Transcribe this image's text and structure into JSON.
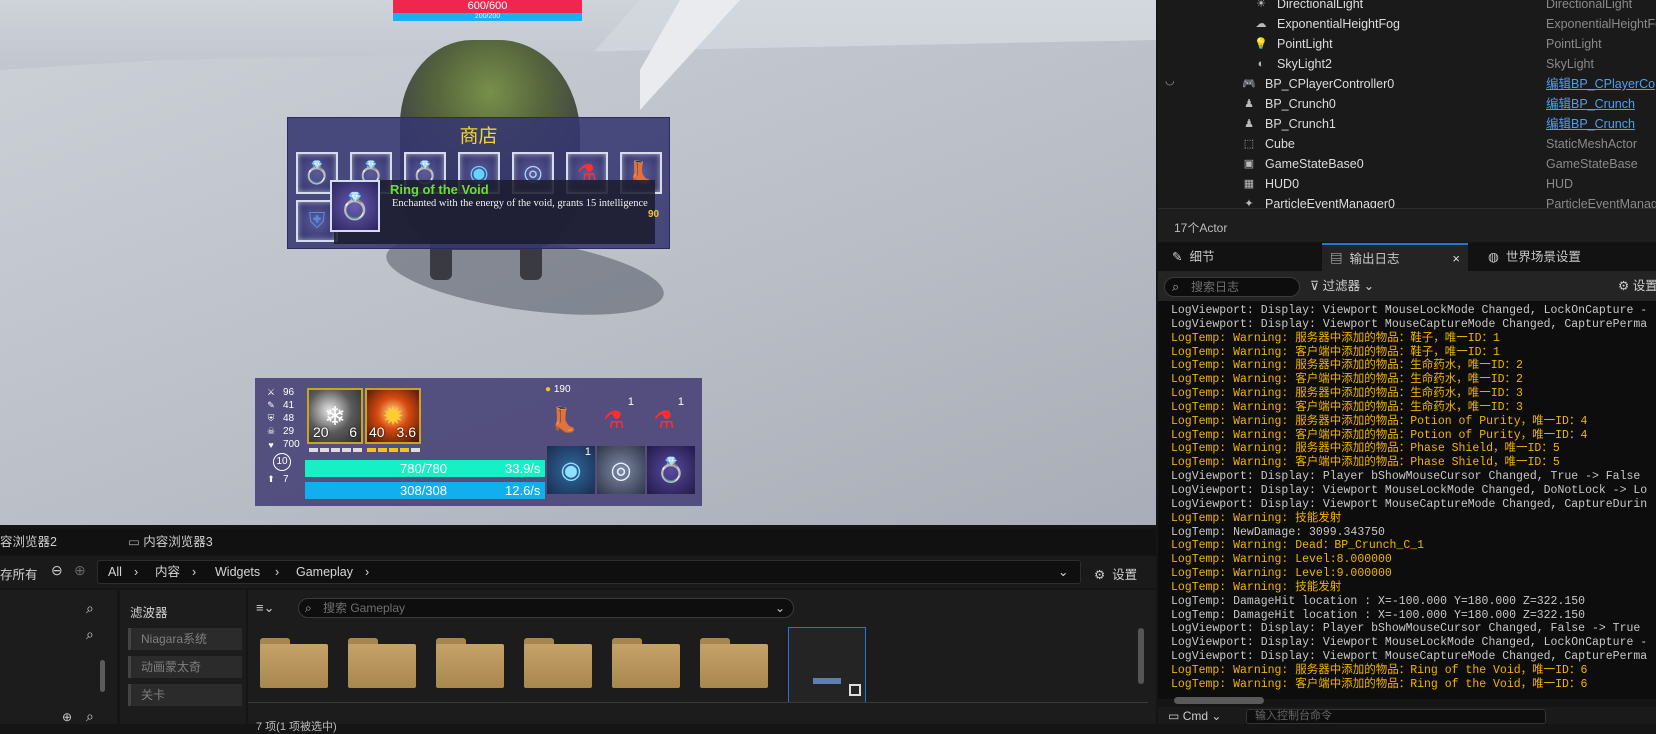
{
  "game": {
    "enemy_hp": "600/600",
    "enemy_mp": "200/200",
    "shop": {
      "title": "商店",
      "slots": [
        "ring-purple",
        "ring-gold",
        "ring-blue",
        "orb-cyan",
        "orb-shield",
        "potion-red",
        "boots-black",
        "armor-blue"
      ],
      "tooltip": {
        "name": "Ring of the Void",
        "description": "Enchanted with the energy of the void, grants 15 intelligence",
        "price": "90"
      }
    },
    "hud": {
      "stats": [
        {
          "icon": "sword-icon",
          "glyph": "⚔",
          "value": "96"
        },
        {
          "icon": "wand-icon",
          "glyph": "✎",
          "value": "41"
        },
        {
          "icon": "shield-icon",
          "glyph": "⛨",
          "value": "48"
        },
        {
          "icon": "mask-icon",
          "glyph": "☠",
          "value": "29"
        },
        {
          "icon": "heart-icon",
          "glyph": "♥",
          "value": "700"
        }
      ],
      "level": "10",
      "points": "7",
      "skills": [
        {
          "icon": "frost-skill-icon",
          "left_value": "20",
          "right_value": "6"
        },
        {
          "icon": "fire-skill-icon",
          "left_value": "40",
          "right_value": "3.6"
        }
      ],
      "hp": {
        "text": "780/780",
        "rate": "33.9/s",
        "fill": 1.0,
        "color": "#17f0c4"
      },
      "mp": {
        "text": "308/308",
        "rate": "12.6/s",
        "fill": 1.0,
        "color": "#11aef0"
      },
      "gold": "190",
      "inventory": [
        {
          "icon": "boots-icon",
          "count": ""
        },
        {
          "icon": "red-potion-icon",
          "count": "1"
        },
        {
          "icon": "red-potion-icon",
          "count": "1"
        },
        {
          "icon": "blue-orb-icon",
          "count": "1"
        },
        {
          "icon": "shield-orb-icon",
          "count": ""
        },
        {
          "icon": "void-ring-icon",
          "count": ""
        }
      ]
    }
  },
  "outliner": {
    "rows": [
      {
        "icon": "light-icon",
        "name": "DirectionalLight",
        "type": "DirectionalLight",
        "link": false,
        "indent": 2
      },
      {
        "icon": "fog-icon",
        "name": "ExponentialHeightFog",
        "type": "ExponentialHeightFog",
        "link": false,
        "indent": 2
      },
      {
        "icon": "bulb-icon",
        "name": "PointLight",
        "type": "PointLight",
        "link": false,
        "indent": 2
      },
      {
        "icon": "skylight-icon",
        "name": "SkyLight2",
        "type": "SkyLight",
        "link": false,
        "indent": 2
      },
      {
        "icon": "gamepad-icon",
        "name": "BP_CPlayerController0",
        "type": "编辑BP_CPlayerCo",
        "link": true,
        "indent": 1
      },
      {
        "icon": "pawn-icon",
        "name": "BP_Crunch0",
        "type": "编辑BP_Crunch",
        "link": true,
        "indent": 1
      },
      {
        "icon": "pawn-icon",
        "name": "BP_Crunch1",
        "type": "编辑BP_Crunch",
        "link": true,
        "indent": 1
      },
      {
        "icon": "cube-icon",
        "name": "Cube",
        "type": "StaticMeshActor",
        "link": false,
        "indent": 1
      },
      {
        "icon": "gamestate-icon",
        "name": "GameStateBase0",
        "type": "GameStateBase",
        "link": false,
        "indent": 1
      },
      {
        "icon": "hud-icon",
        "name": "HUD0",
        "type": "HUD",
        "link": false,
        "indent": 1
      },
      {
        "icon": "particle-icon",
        "name": "ParticleEventManager0",
        "type": "ParticleEventManag",
        "link": false,
        "indent": 1
      }
    ],
    "actor_count": "17个Actor"
  },
  "panel_tabs": [
    {
      "label": "细节",
      "icon": "pencil-icon",
      "active": false
    },
    {
      "label": "输出日志",
      "icon": "log-icon",
      "active": true
    },
    {
      "label": "世界场景设置",
      "icon": "globe-icon",
      "active": false
    }
  ],
  "log_toolbar": {
    "search_placeholder": "搜索日志",
    "filter": "过滤器",
    "settings": "设置"
  },
  "log_lines": [
    {
      "t": "d",
      "s": "LogViewport: Display: Viewport MouseLockMode Changed, LockOnCapture -"
    },
    {
      "t": "d",
      "s": "LogViewport: Display: Viewport MouseCaptureMode Changed, CapturePerma"
    },
    {
      "t": "w",
      "s": "LogTemp: Warning: 服务器中添加的物品：鞋子，唯一ID：1"
    },
    {
      "t": "w",
      "s": "LogTemp: Warning: 客户端中添加的物品：鞋子，唯一ID：1"
    },
    {
      "t": "w",
      "s": "LogTemp: Warning: 服务器中添加的物品：生命药水，唯一ID：2"
    },
    {
      "t": "w",
      "s": "LogTemp: Warning: 客户端中添加的物品：生命药水，唯一ID：2"
    },
    {
      "t": "w",
      "s": "LogTemp: Warning: 服务器中添加的物品：生命药水，唯一ID：3"
    },
    {
      "t": "w",
      "s": "LogTemp: Warning: 客户端中添加的物品：生命药水，唯一ID：3"
    },
    {
      "t": "w",
      "s": "LogTemp: Warning: 服务器中添加的物品：Potion of Purity，唯一ID：4"
    },
    {
      "t": "w",
      "s": "LogTemp: Warning: 客户端中添加的物品：Potion of Purity，唯一ID：4"
    },
    {
      "t": "w",
      "s": "LogTemp: Warning: 服务器中添加的物品：Phase Shield，唯一ID：5"
    },
    {
      "t": "w",
      "s": "LogTemp: Warning: 客户端中添加的物品：Phase Shield，唯一ID：5"
    },
    {
      "t": "d",
      "s": "LogViewport: Display: Player bShowMouseCursor Changed, True -> False"
    },
    {
      "t": "d",
      "s": "LogViewport: Display: Viewport MouseLockMode Changed, DoNotLock -> Lo"
    },
    {
      "t": "d",
      "s": "LogViewport: Display: Viewport MouseCaptureMode Changed, CaptureDurin"
    },
    {
      "t": "w",
      "s": "LogTemp: Warning: 技能发射"
    },
    {
      "t": "d",
      "s": "LogTemp: NewDamage: 3099.343750"
    },
    {
      "t": "w",
      "s": "LogTemp: Warning: Dead：BP_Crunch_C_1"
    },
    {
      "t": "w",
      "s": "LogTemp: Warning: Level:8.000000"
    },
    {
      "t": "w",
      "s": "LogTemp: Warning: Level:9.000000"
    },
    {
      "t": "w",
      "s": "LogTemp: Warning: 技能发射"
    },
    {
      "t": "d",
      "s": "LogTemp: DamageHit location : X=-100.000 Y=180.000 Z=322.150"
    },
    {
      "t": "d",
      "s": "LogTemp: DamageHit location : X=-100.000 Y=180.000 Z=322.150"
    },
    {
      "t": "d",
      "s": "LogViewport: Display: Player bShowMouseCursor Changed, False -> True"
    },
    {
      "t": "d",
      "s": "LogViewport: Display: Viewport MouseLockMode Changed, LockOnCapture -"
    },
    {
      "t": "d",
      "s": "LogViewport: Display: Viewport MouseCaptureMode Changed, CapturePerma"
    },
    {
      "t": "w",
      "s": "LogTemp: Warning: 服务器中添加的物品：Ring of the Void，唯一ID：6"
    },
    {
      "t": "w",
      "s": "LogTemp: Warning: 客户端中添加的物品：Ring of the Void，唯一ID：6"
    }
  ],
  "cmd": {
    "label": "Cmd",
    "placeholder": "输入控制台命令"
  },
  "content_browser": {
    "tabs": [
      "容浏览器2",
      "内容浏览器3"
    ],
    "save_all": "存所有",
    "breadcrumbs": [
      "All",
      "内容",
      "Widgets",
      "Gameplay"
    ],
    "settings": "设置",
    "filter_title": "滤波器",
    "filters": [
      "Niagara系统",
      "动画蒙太奇",
      "关卡"
    ],
    "search_placeholder": "搜索 Gameplay",
    "status": "7 项(1 项被选中)",
    "folder_count": 6
  }
}
